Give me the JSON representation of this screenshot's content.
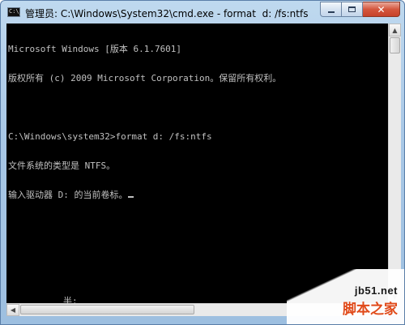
{
  "window": {
    "icon_label": "C:\\_",
    "title": "管理员: C:\\Windows\\System32\\cmd.exe - format  d: /fs:ntfs"
  },
  "console": {
    "lines": [
      "Microsoft Windows [版本 6.1.7601]",
      "版权所有 (c) 2009 Microsoft Corporation。保留所有权利。",
      "",
      "C:\\Windows\\system32>format d: /fs:ntfs",
      "文件系统的类型是 NTFS。",
      "输入驱动器 D: 的当前卷标。"
    ],
    "ime_status": "半:"
  },
  "scrollbars": {
    "up_arrow": "▲",
    "down_arrow": "▼",
    "left_arrow": "◀",
    "right_arrow": "▶"
  },
  "watermark": {
    "url": "jb51.net",
    "name": "脚本之家"
  }
}
